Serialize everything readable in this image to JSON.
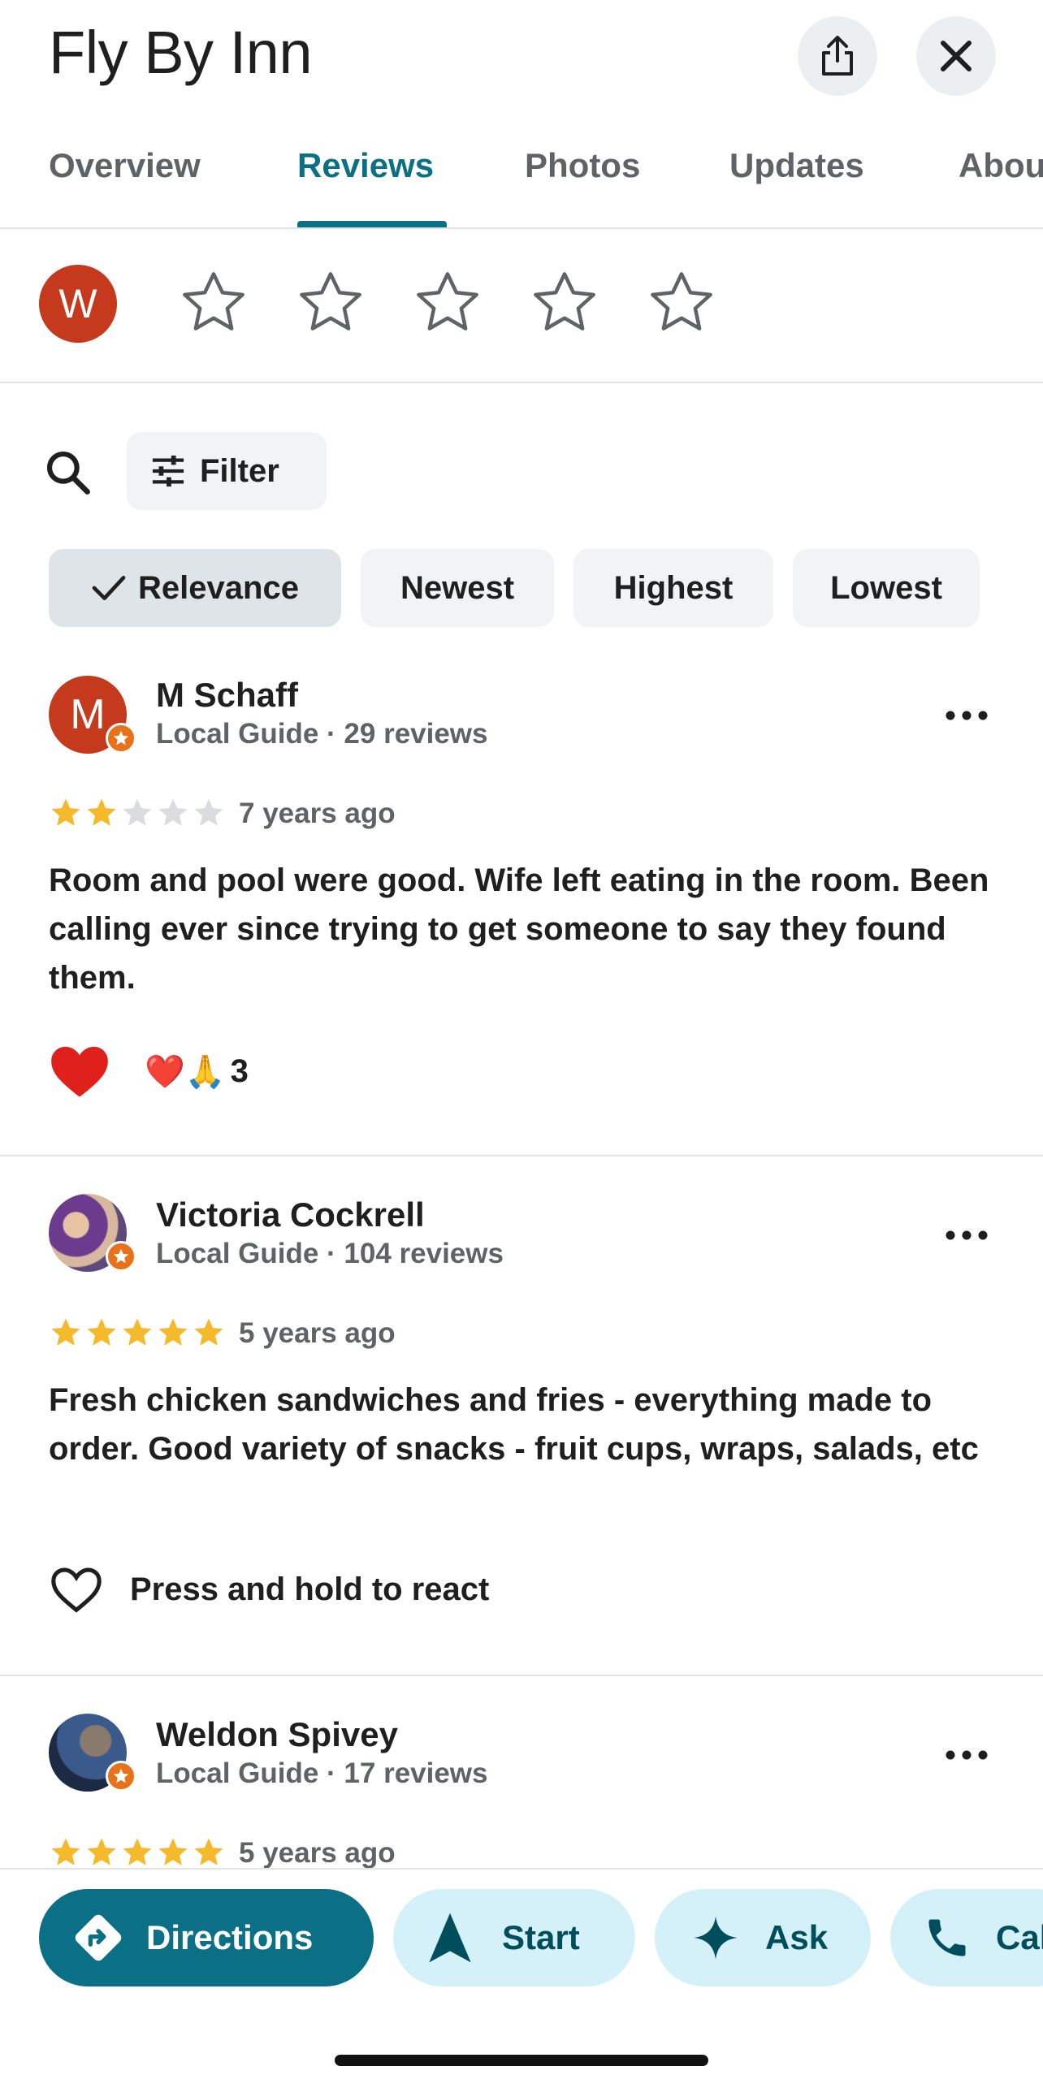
{
  "header": {
    "title": "Fly By Inn"
  },
  "tabs": [
    {
      "label": "Overview"
    },
    {
      "label": "Reviews",
      "active": true
    },
    {
      "label": "Photos"
    },
    {
      "label": "Updates"
    },
    {
      "label": "About"
    }
  ],
  "rate": {
    "user_initial": "W",
    "star_count": 5
  },
  "filter": {
    "label": "Filter"
  },
  "sort": [
    {
      "label": "Relevance",
      "selected": true
    },
    {
      "label": "Newest"
    },
    {
      "label": "Highest"
    },
    {
      "label": "Lowest"
    }
  ],
  "reviews": [
    {
      "initial": "M",
      "name": "M Schaff",
      "sub": "Local Guide · 29 reviews",
      "rating": 2,
      "date": "7 years ago",
      "text": "Room and pool were good. Wife left eating in the room. Been calling ever since trying to get someone to say they found them.",
      "reactions": {
        "emojis": "❤️🙏",
        "count": "3"
      }
    },
    {
      "name": "Victoria Cockrell",
      "sub": "Local Guide · 104 reviews",
      "rating": 5,
      "date": "5 years ago",
      "text": "Fresh chicken sandwiches and fries - everything made to order. Good variety of snacks - fruit cups, wraps, salads, etc",
      "react_prompt": "Press and hold to react"
    },
    {
      "name": "Weldon Spivey",
      "sub": "Local Guide · 17 reviews",
      "rating": 5,
      "date": "5 years ago"
    }
  ],
  "actions": [
    {
      "label": "Directions",
      "icon": "directions-icon"
    },
    {
      "label": "Start",
      "icon": "navigation-arrow-icon"
    },
    {
      "label": "Ask",
      "icon": "sparkle-icon"
    },
    {
      "label": "Call",
      "icon": "phone-icon"
    }
  ],
  "colors": {
    "accent": "#0b7085",
    "star": "#f6b92b",
    "star_empty": "#dadce0",
    "avatar_red": "#c5391c",
    "guide_badge": "#e8711a"
  }
}
